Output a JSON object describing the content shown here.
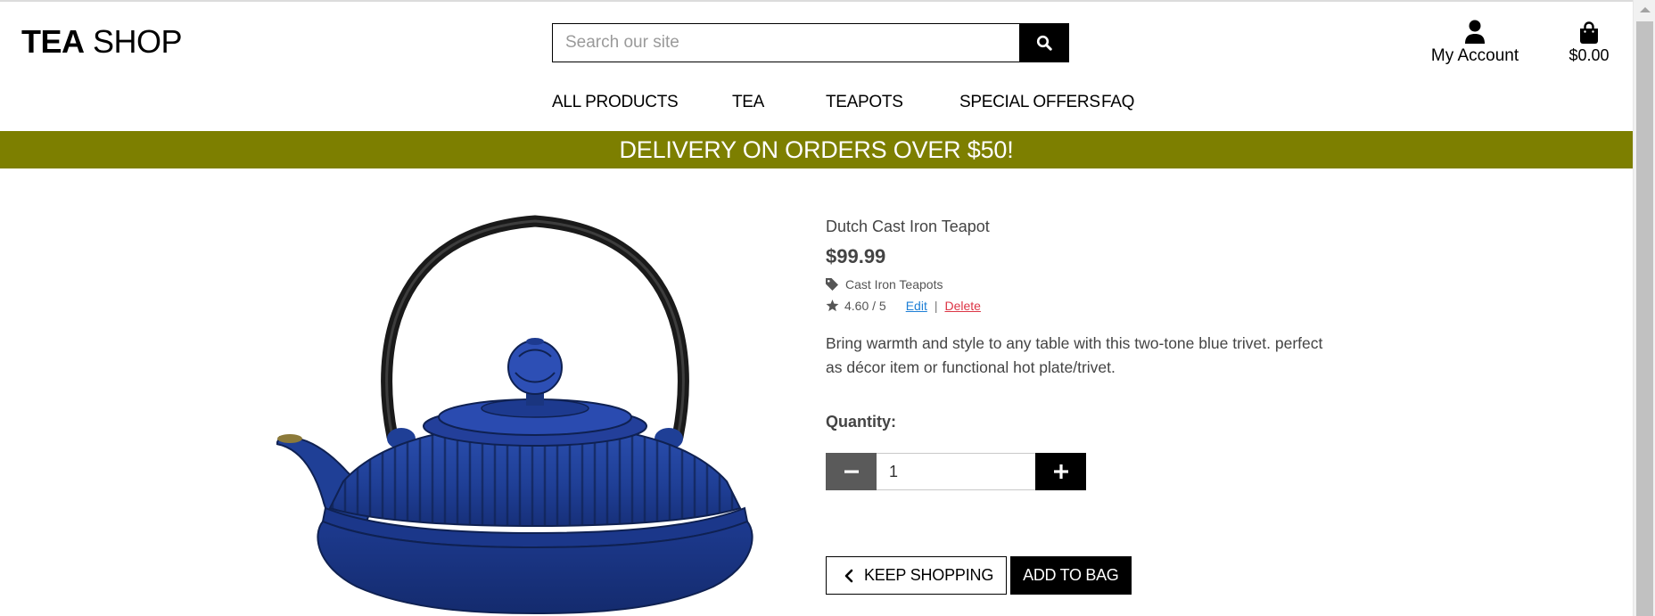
{
  "header": {
    "logo_bold": "TEA",
    "logo_light": "SHOP",
    "search_placeholder": "Search our site",
    "account_label": "My Account",
    "bag_total": "$0.00",
    "icons": {
      "search": "search-icon",
      "account": "user-icon",
      "bag": "shopping-bag-icon"
    }
  },
  "nav": {
    "items": [
      "ALL PRODUCTS",
      "TEA",
      "TEAPOTS",
      "SPECIAL OFFERS",
      "FAQ"
    ]
  },
  "banner": {
    "text": "DELIVERY ON ORDERS OVER $50!",
    "color": "#7d7f00"
  },
  "product": {
    "name": "Dutch Cast Iron Teapot",
    "price": "$99.99",
    "category": "Cast Iron Teapots",
    "rating": "4.60 / 5",
    "edit_label": "Edit",
    "separator": "|",
    "delete_label": "Delete",
    "description": "Bring warmth and style to any table with this two-tone blue trivet. perfect as décor item or functional hot plate/trivet.",
    "quantity_label": "Quantity:",
    "quantity_value": "1",
    "image": "blue-cast-iron-teapot"
  },
  "actions": {
    "keep_shopping": "KEEP SHOPPING",
    "add_to_bag": "ADD TO BAG"
  },
  "colors": {
    "accent": "#7d7f00",
    "edit_link": "#1e7fd6",
    "delete_link": "#dc3545",
    "teapot_blue": "#1f3f96"
  }
}
